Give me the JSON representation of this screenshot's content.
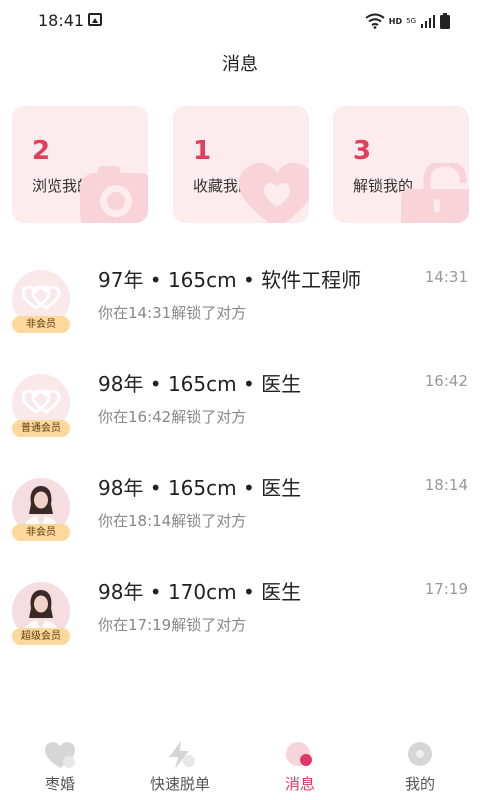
{
  "status_bar": {
    "time": "18:41",
    "hd": "HD",
    "net": "5G"
  },
  "header": {
    "title": "消息"
  },
  "stats": [
    {
      "count": "2",
      "label": "浏览我的",
      "icon": "camera-icon"
    },
    {
      "count": "1",
      "label": "收藏我的",
      "icon": "heart-icon"
    },
    {
      "count": "3",
      "label": "解锁我的",
      "icon": "unlock-icon"
    }
  ],
  "messages": [
    {
      "title": "97年 • 165cm • 软件工程师",
      "subtitle": "你在14:31解锁了对方",
      "time": "14:31",
      "badge": "非会员",
      "avatar": "default-avatar"
    },
    {
      "title": "98年 • 165cm • 医生",
      "subtitle": "你在16:42解锁了对方",
      "time": "16:42",
      "badge": "普通会员",
      "avatar": "default-avatar"
    },
    {
      "title": "98年 • 165cm • 医生",
      "subtitle": "你在18:14解锁了对方",
      "time": "18:14",
      "badge": "非会员",
      "avatar": "photo-avatar"
    },
    {
      "title": "98年 • 170cm • 医生",
      "subtitle": "你在17:19解锁了对方",
      "time": "17:19",
      "badge": "超级会员",
      "avatar": "photo-avatar"
    }
  ],
  "nav": {
    "items": [
      {
        "label": "枣婚",
        "icon": "heart-chat-icon",
        "active": false
      },
      {
        "label": "快速脱单",
        "icon": "lightning-icon",
        "active": false
      },
      {
        "label": "消息",
        "icon": "message-icon",
        "active": true
      },
      {
        "label": "我的",
        "icon": "profile-icon",
        "active": false
      }
    ]
  },
  "colors": {
    "accent": "#e03e5a",
    "card_bg": "#fdecee",
    "badge_bg": "#fbd99c",
    "active_nav": "#e0376a"
  }
}
